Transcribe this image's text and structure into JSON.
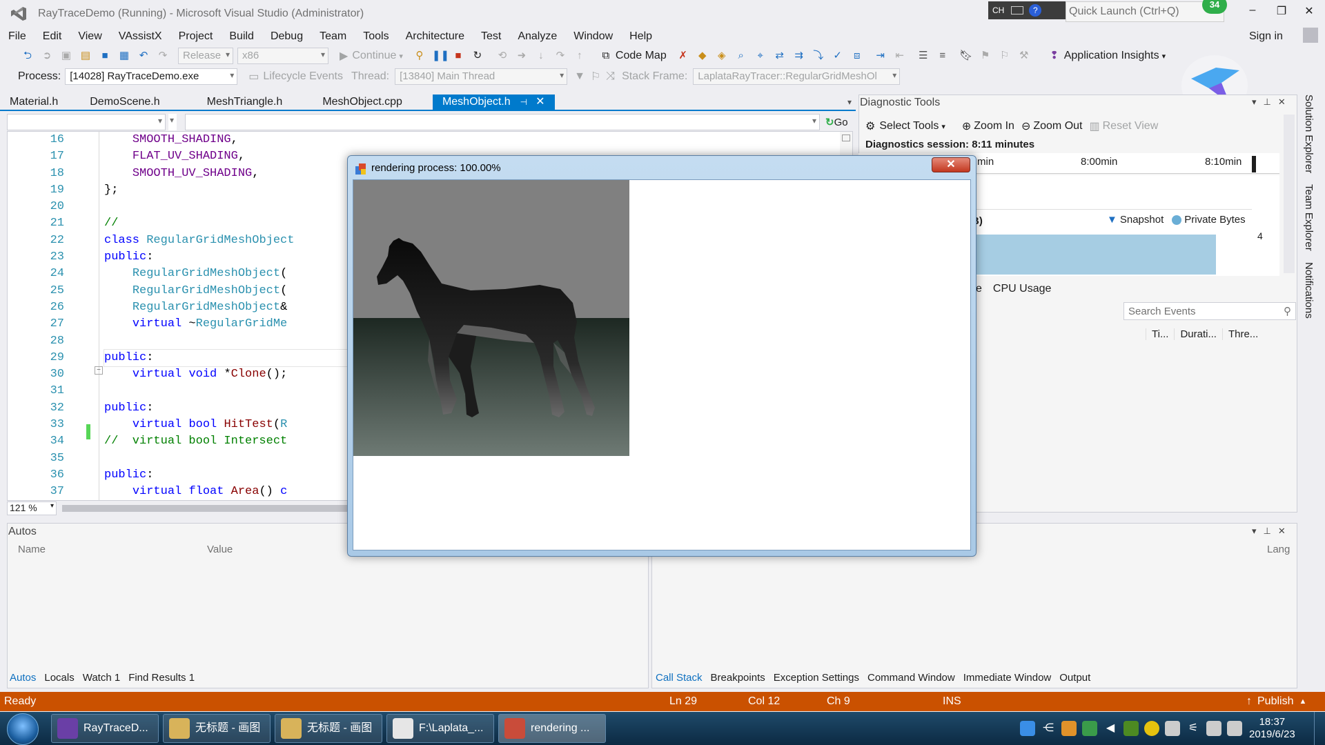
{
  "window": {
    "title": "RayTraceDemo (Running) - Microsoft Visual Studio (Administrator)",
    "ime": "CH",
    "quick_launch_placeholder": "Quick Launch (Ctrl+Q)",
    "notification_count": "34"
  },
  "menu": [
    "File",
    "Edit",
    "View",
    "VAssistX",
    "Project",
    "Build",
    "Debug",
    "Team",
    "Tools",
    "Architecture",
    "Test",
    "Analyze",
    "Window",
    "Help"
  ],
  "sign_in": "Sign in",
  "toolbar": {
    "config": "Release",
    "platform": "x86",
    "continue": "Continue",
    "code_map": "Code Map",
    "app_insights": "Application Insights"
  },
  "debugbar": {
    "process_label": "Process:",
    "process_value": "[14028] RayTraceDemo.exe",
    "lifecycle": "Lifecycle Events",
    "thread_label": "Thread:",
    "thread_value": "[13840] Main Thread",
    "stack_label": "Stack Frame:",
    "stack_value": "LaplataRayTracer::RegularGridMeshOl"
  },
  "doc_tabs": [
    "Material.h",
    "DemoScene.h",
    "MeshTriangle.h",
    "MeshObject.cpp",
    "MeshObject.h"
  ],
  "go_label": "Go",
  "editor": {
    "line_numbers": [
      "16",
      "17",
      "18",
      "19",
      "20",
      "21",
      "22",
      "23",
      "24",
      "25",
      "26",
      "27",
      "28",
      "29",
      "30",
      "31",
      "32",
      "33",
      "34",
      "35",
      "36",
      "37"
    ],
    "zoom": "121 %"
  },
  "diagnostics": {
    "title": "Diagnostic Tools",
    "select_tools": "Select Tools",
    "zoom_in": "Zoom In",
    "zoom_out": "Zoom Out",
    "reset_view": "Reset View",
    "session": "Diagnostics session: 8:11 minutes",
    "ticks": [
      "min",
      "8:00min",
      "8:10min"
    ],
    "mem_unit": "B)",
    "legend_snapshot": "Snapshot",
    "legend_private": "Private Bytes",
    "mem_value": "4",
    "tab_partial": "e",
    "tab_cpu": "CPU Usage",
    "search_placeholder": "Search Events",
    "event_cols": [
      "Ti...",
      "Durati...",
      "Thre..."
    ]
  },
  "side_tabs": [
    "Solution Explorer",
    "Team Explorer",
    "Notifications"
  ],
  "autos": {
    "title": "Autos",
    "col_name": "Name",
    "col_value": "Value",
    "tabs": [
      "Autos",
      "Locals",
      "Watch 1",
      "Find Results 1"
    ]
  },
  "callstack": {
    "tabs": [
      "Call Stack",
      "Breakpoints",
      "Exception Settings",
      "Command Window",
      "Immediate Window",
      "Output"
    ],
    "lang_col": "Lang"
  },
  "status": {
    "ready": "Ready",
    "ln": "Ln 29",
    "col": "Col 12",
    "ch": "Ch 9",
    "ins": "INS",
    "publish": "Publish"
  },
  "render_window": {
    "title": "rendering process: 100.00%"
  },
  "taskbar": {
    "items": [
      "RayTraceD...",
      "无标题 - 画图",
      "无标题 - 画图",
      "F:\\Laplata_...",
      "rendering ..."
    ],
    "time": "18:37",
    "date": "2019/6/23"
  },
  "colors": {
    "accent": "#007acc",
    "status_bar": "#ca5100",
    "taskbar": "#0c2a43"
  }
}
